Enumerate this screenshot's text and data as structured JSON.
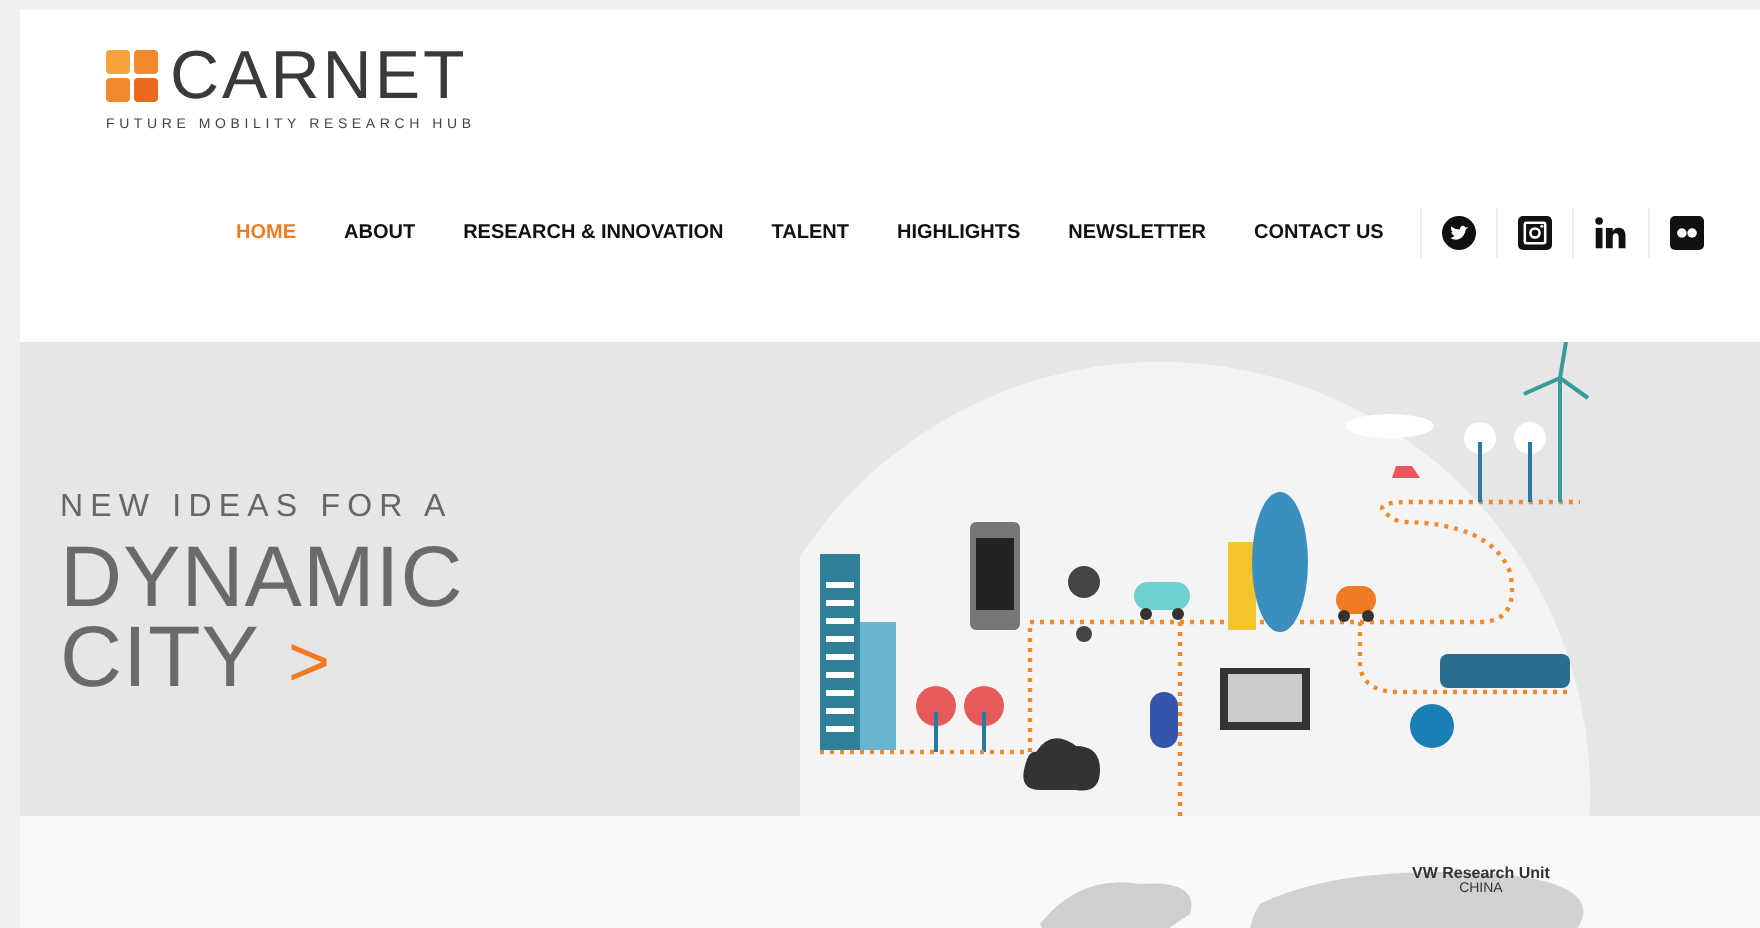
{
  "logo": {
    "name": "CARNET",
    "tagline": "FUTURE MOBILITY RESEARCH HUB"
  },
  "nav": [
    {
      "label": "HOME",
      "selected": true
    },
    {
      "label": "ABOUT",
      "selected": false
    },
    {
      "label": "RESEARCH & INNOVATION",
      "selected": false
    },
    {
      "label": "TALENT",
      "selected": false
    },
    {
      "label": "HIGHLIGHTS",
      "selected": false
    },
    {
      "label": "NEWSLETTER",
      "selected": false
    },
    {
      "label": "CONTACT US",
      "selected": false
    }
  ],
  "hero": {
    "kicker": "NEW IDEAS FOR A",
    "headline": [
      "DYNAMIC",
      "CITY"
    ],
    "arrow": ">"
  },
  "map": {
    "label": "VW Research Unit",
    "sublabel": "CHINA"
  }
}
